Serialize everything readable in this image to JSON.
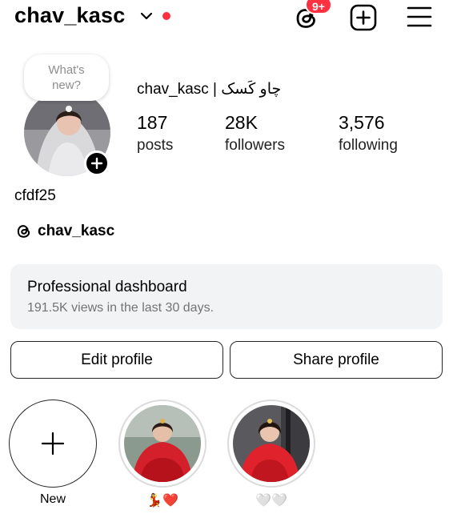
{
  "header": {
    "username": "chav_kasc",
    "notification_badge": "9+",
    "accent_color": "#ff3040",
    "icons": [
      "chevron-down-icon",
      "threads-icon",
      "create-post-icon",
      "menu-icon"
    ]
  },
  "profile": {
    "note_prompt": "What's new?",
    "full_name": "chav_kasc | چاو کَسک",
    "stats": [
      {
        "value": "187",
        "label": "posts"
      },
      {
        "value": "28K",
        "label": "followers"
      },
      {
        "value": "3,576",
        "label": "following"
      }
    ],
    "bio": "cfdf25",
    "threads_handle": "chav_kasc"
  },
  "dashboard": {
    "title": "Professional dashboard",
    "subtitle": "191.5K views in the last 30 days."
  },
  "actions": {
    "edit_label": "Edit profile",
    "share_label": "Share profile"
  },
  "highlights": [
    {
      "label": "New"
    },
    {
      "label": "💃❤️"
    },
    {
      "label": "🤍🤍"
    }
  ]
}
